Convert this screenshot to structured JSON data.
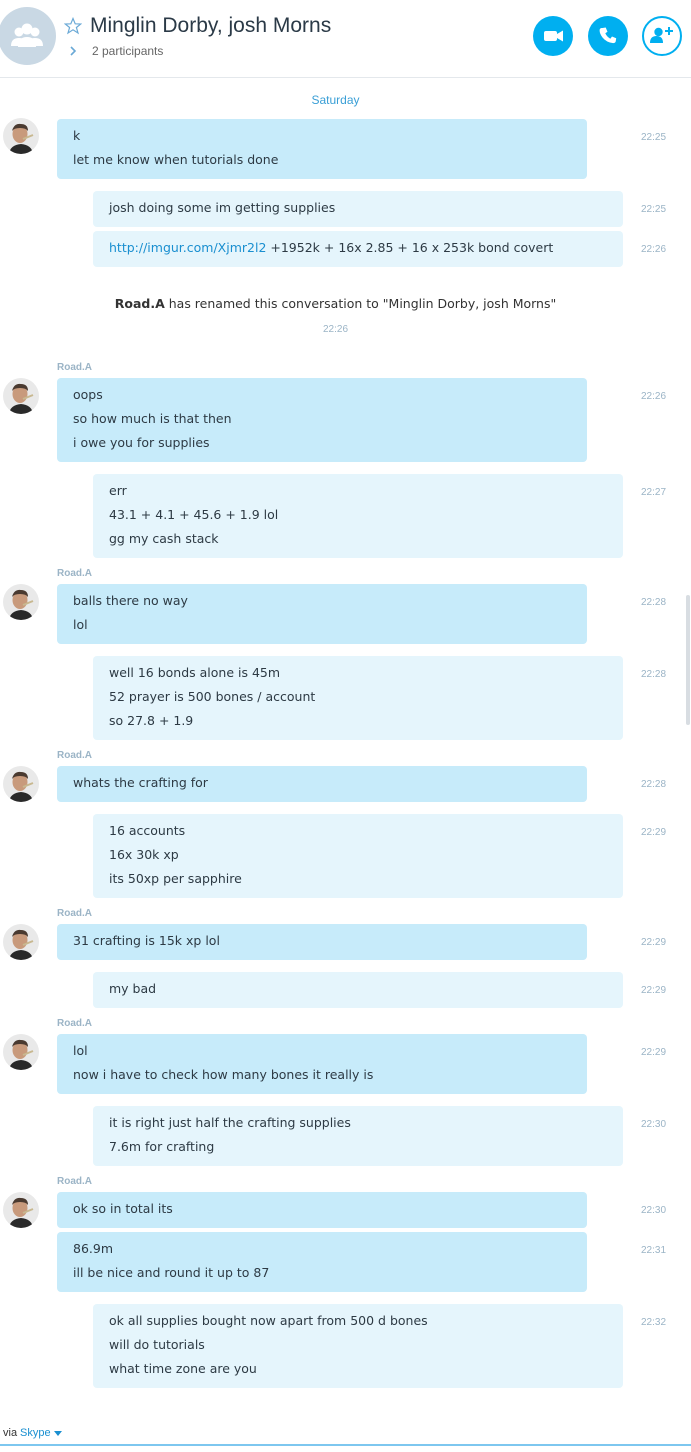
{
  "header": {
    "title": "Minglin Dorby, josh Morns",
    "participants": "2 participants",
    "accent_color": "#00aff0"
  },
  "chat": {
    "day_separator": "Saturday",
    "rename_notice": {
      "who": "Road.A",
      "text": " has renamed this conversation to \"Minglin Dorby, josh Morns\"",
      "time": "22:26"
    },
    "messages": [
      {
        "dir": "in",
        "sender": "",
        "lines": [
          "k",
          "let me know when tutorials done"
        ],
        "time": "22:25"
      },
      {
        "dir": "out",
        "lines": [
          "josh doing some im getting supplies"
        ],
        "time": "22:25"
      },
      {
        "dir": "out",
        "link": "http://imgur.com/Xjmr2l2",
        "lines": [
          " +1952k + 16x 2.85 + 16 x 253k bond covert"
        ],
        "time": "22:26"
      },
      {
        "dir": "in",
        "sender": "Road.A",
        "lines": [
          "oops",
          "so how much is that then",
          "i owe you for supplies"
        ],
        "time": "22:26"
      },
      {
        "dir": "out",
        "lines": [
          "err",
          "43.1 + 4.1 + 45.6 + 1.9 lol",
          "gg my cash stack"
        ],
        "time": "22:27"
      },
      {
        "dir": "in",
        "sender": "Road.A",
        "lines": [
          "balls there no way",
          "lol"
        ],
        "time": "22:28"
      },
      {
        "dir": "out",
        "lines": [
          "well 16 bonds alone is 45m",
          "52 prayer is 500 bones / account",
          "so 27.8 + 1.9"
        ],
        "time": "22:28"
      },
      {
        "dir": "in",
        "sender": "Road.A",
        "lines": [
          "whats the crafting for"
        ],
        "time": "22:28"
      },
      {
        "dir": "out",
        "lines": [
          "16 accounts",
          "16x 30k xp",
          "its 50xp per sapphire"
        ],
        "time": "22:29"
      },
      {
        "dir": "in",
        "sender": "Road.A",
        "lines": [
          "31 crafting is 15k xp lol"
        ],
        "time": "22:29"
      },
      {
        "dir": "out",
        "lines": [
          "my bad"
        ],
        "time": "22:29"
      },
      {
        "dir": "in",
        "sender": "Road.A",
        "lines": [
          "lol",
          "now i have to check how many bones it really is"
        ],
        "time": "22:29"
      },
      {
        "dir": "out",
        "lines": [
          "it is right just half the crafting supplies",
          "7.6m for crafting"
        ],
        "time": "22:30"
      },
      {
        "dir": "in",
        "sender": "Road.A",
        "lines": [
          "ok so in total its"
        ],
        "time": "22:30"
      },
      {
        "dir": "in",
        "sender": "",
        "avatar": false,
        "lines": [
          "86.9m",
          "ill be nice and round it up to 87"
        ],
        "time": "22:31"
      },
      {
        "dir": "out",
        "lines": [
          "ok all supplies bought now apart from 500 d bones",
          "will do tutorials",
          "what time zone are you"
        ],
        "time": "22:32"
      }
    ]
  },
  "footer": {
    "via": "via",
    "app": "Skype"
  }
}
